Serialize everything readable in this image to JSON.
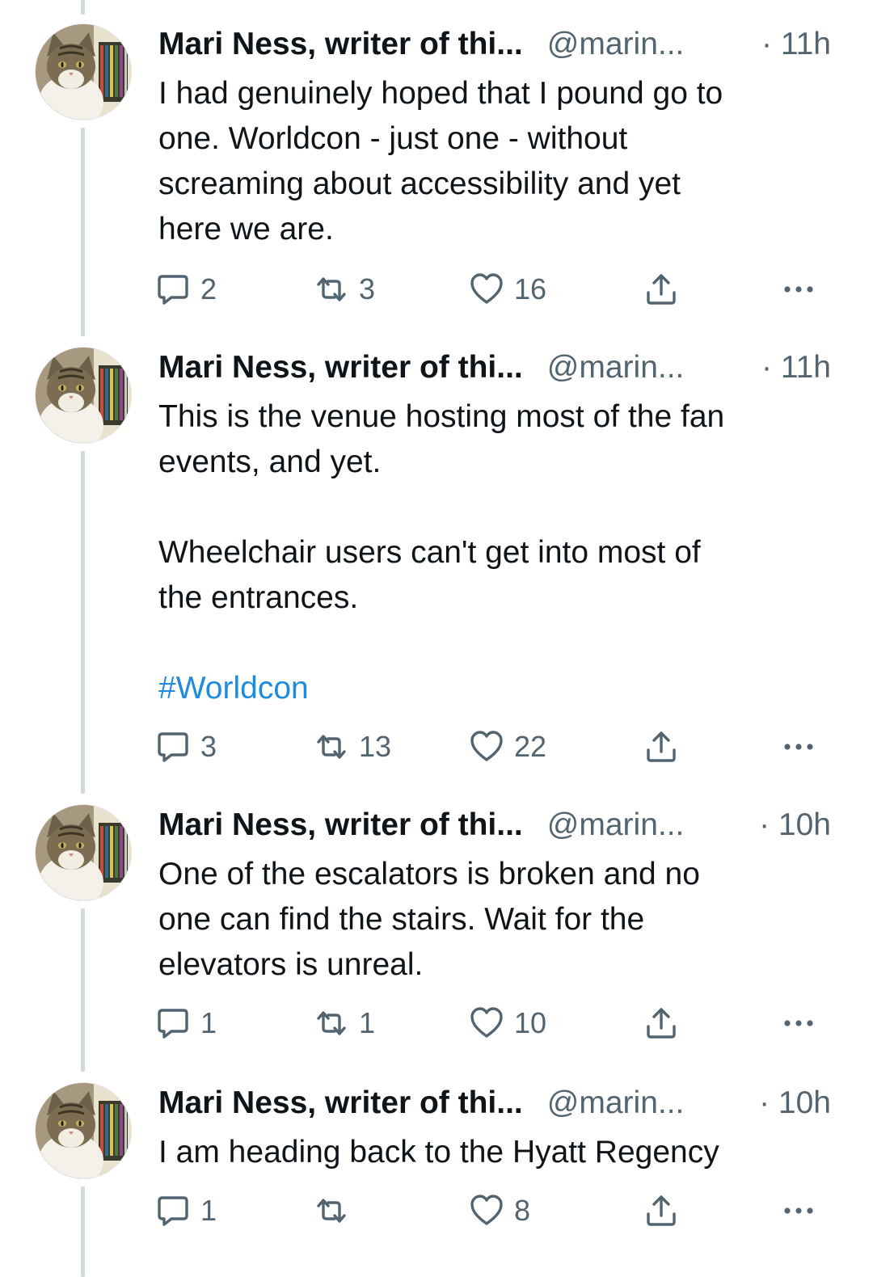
{
  "colors": {
    "text": "#0f1419",
    "secondary": "#536471",
    "hashtag": "#1d8ce0",
    "thread_line": "#cfd9de"
  },
  "icons": {
    "reply": "speech-bubble-icon",
    "retweet": "retweet-arrows-icon",
    "like": "heart-icon",
    "share": "share-upload-icon",
    "more": "ellipsis-icon",
    "avatar": "tabby-cat-photo"
  },
  "tweets": [
    {
      "name": "Mari Ness, writer of thi...",
      "handle": "@marin...",
      "time": "· 11h",
      "text_lines": [
        "I had genuinely hoped that I pound go to",
        "one. Worldcon  - just one - without",
        "screaming about accessibility and yet",
        "here we are."
      ],
      "replies": "2",
      "retweets": "3",
      "likes": "16"
    },
    {
      "name": "Mari Ness, writer of thi...",
      "handle": "@marin...",
      "time": "· 11h",
      "paragraph1": [
        "This is the venue hosting most of the fan",
        "events, and yet."
      ],
      "paragraph2": [
        "Wheelchair users can't get into most of",
        "the entrances."
      ],
      "hashtag": "#Worldcon",
      "replies": "3",
      "retweets": "13",
      "likes": "22"
    },
    {
      "name": "Mari Ness, writer of thi...",
      "handle": "@marin...",
      "time": "· 10h",
      "text_lines": [
        "One of the escalators is broken and no",
        "one can find the stairs. Wait for the",
        "elevators is unreal."
      ],
      "replies": "1",
      "retweets": "1",
      "likes": "10"
    },
    {
      "name": "Mari Ness, writer of thi...",
      "handle": "@marin...",
      "time": "· 10h",
      "text_lines": [
        "I am heading back to the Hyatt Regency"
      ],
      "replies": "1",
      "retweets": "",
      "likes": "8"
    }
  ]
}
